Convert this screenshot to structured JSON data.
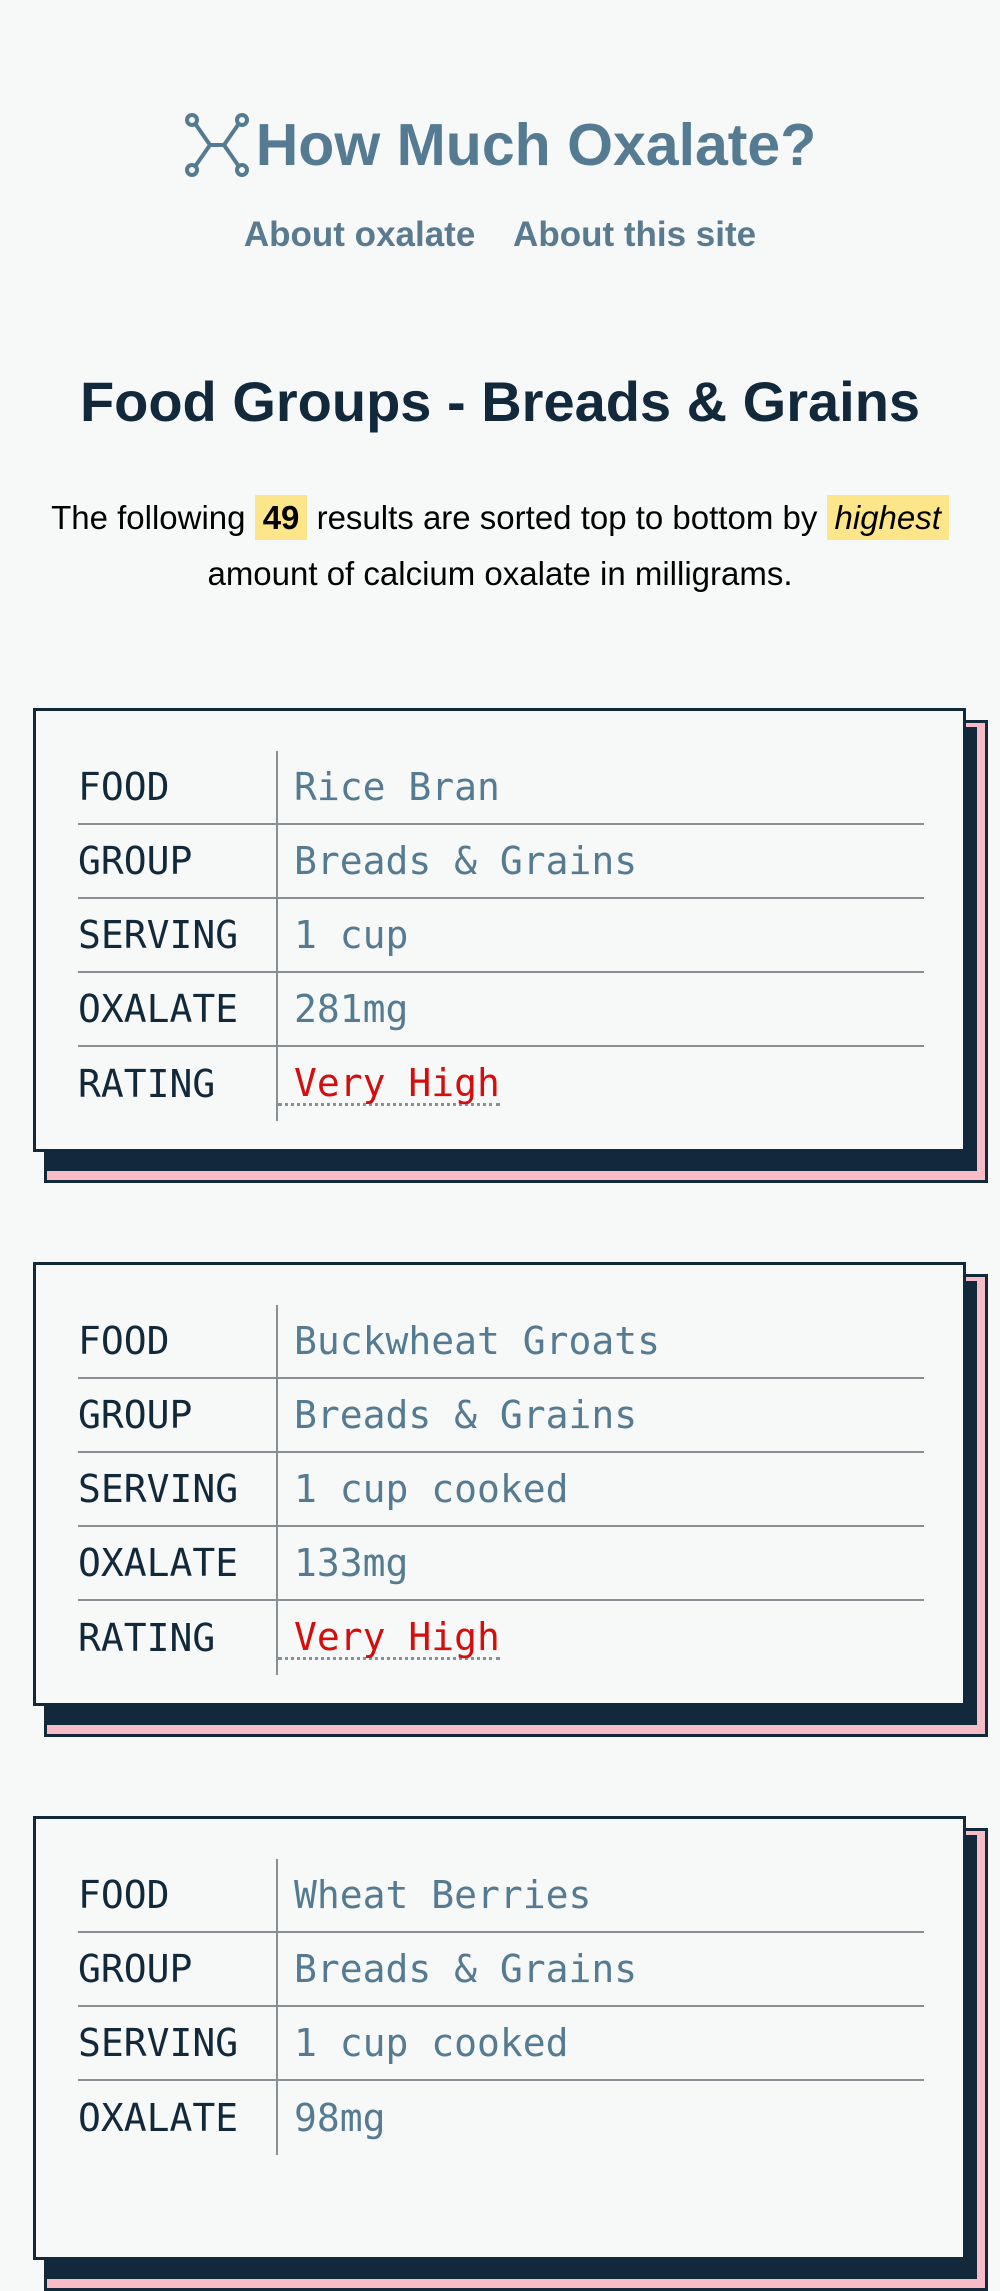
{
  "site": {
    "title": "How Much Oxalate?",
    "logo_icon": "molecule-icon"
  },
  "nav": [
    {
      "label": "About oxalate"
    },
    {
      "label": "About this site"
    }
  ],
  "page": {
    "title": "Food Groups - Breads & Grains",
    "intro_before": "The following",
    "result_count": "49",
    "intro_middle": "results are sorted top to bottom by",
    "sort_word": "highest",
    "intro_after": "amount of calcium oxalate in milligrams."
  },
  "labels": {
    "food": "FOOD",
    "group": "GROUP",
    "serving": "SERVING",
    "oxalate": "OXALATE",
    "rating": "RATING"
  },
  "colors": {
    "heading": "#12293c",
    "accent": "#557b93",
    "highlight": "#fde68a",
    "card_shadow": "#f7bcc5",
    "rating_very_high": "#d40d0d"
  },
  "foods": [
    {
      "food": "Rice Bran",
      "group": "Breads & Grains",
      "serving": "1 cup",
      "oxalate": "281mg",
      "rating": "Very High"
    },
    {
      "food": "Buckwheat Groats",
      "group": "Breads & Grains",
      "serving": "1 cup cooked",
      "oxalate": "133mg",
      "rating": "Very High"
    },
    {
      "food": "Wheat Berries",
      "group": "Breads & Grains",
      "serving": "1 cup cooked",
      "oxalate": "98mg",
      "rating": ""
    }
  ]
}
